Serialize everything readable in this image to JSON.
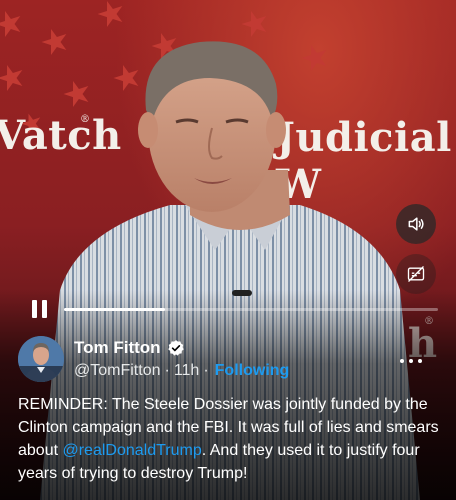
{
  "video": {
    "backdrop_logo_left": "Vatch",
    "backdrop_logo_right": "Judicial W",
    "backdrop_logo_bottom": "h",
    "registered_mark": "®",
    "progress": 0.27
  },
  "controls": {
    "volume_icon": "speaker-icon",
    "captions_icon": "captions-off-icon",
    "pause_icon": "pause-icon"
  },
  "tweet": {
    "author_name": "Tom Fitton",
    "handle": "@TomFitton",
    "separator": "·",
    "time": "11h",
    "follow_status": "Following",
    "text_before": "REMINDER: The Steele Dossier was jointly funded by the Clinton campaign and the FBI. It was full of lies and smears about ",
    "mention": "@realDonaldTrump",
    "text_after": ". And they used it to justify four years of trying to destroy Trump!",
    "more_icon": "more-icon",
    "verified_icon": "verified-icon"
  },
  "colors": {
    "accent": "#1d9bf0",
    "backdrop_red": "#9d2423"
  }
}
